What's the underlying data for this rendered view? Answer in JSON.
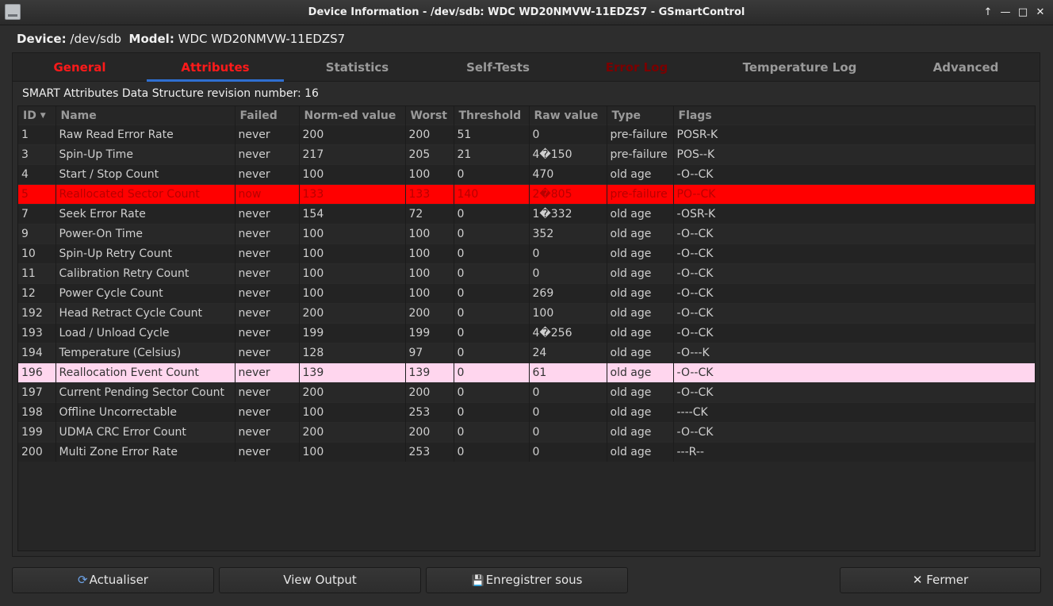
{
  "window": {
    "title": "Device Information - /dev/sdb: WDC WD20NMVW-11EDZS7 - GSmartControl",
    "buttons": [
      "↑",
      "—",
      "□",
      "✕"
    ]
  },
  "device": {
    "device_label": "Device:",
    "device_value": "/dev/sdb",
    "model_label": "Model:",
    "model_value": "WDC WD20NMVW-11EDZS7"
  },
  "tabs": [
    {
      "label": "General"
    },
    {
      "label": "Attributes"
    },
    {
      "label": "Statistics"
    },
    {
      "label": "Self-Tests"
    },
    {
      "label": "Error Log"
    },
    {
      "label": "Temperature Log"
    },
    {
      "label": "Advanced"
    }
  ],
  "revision_text": "SMART Attributes Data Structure revision number: 16",
  "table": {
    "columns": [
      "ID",
      "Name",
      "Failed",
      "Norm-ed value",
      "Worst",
      "Threshold",
      "Raw value",
      "Type",
      "Flags"
    ],
    "rows": [
      [
        "1",
        "Raw Read Error Rate",
        "never",
        "200",
        "200",
        "51",
        "0",
        "pre-failure",
        "POSR-K"
      ],
      [
        "3",
        "Spin-Up Time",
        "never",
        "217",
        "205",
        "21",
        "4�150",
        "pre-failure",
        "POS--K"
      ],
      [
        "4",
        "Start / Stop Count",
        "never",
        "100",
        "100",
        "0",
        "470",
        "old age",
        "-O--CK"
      ],
      [
        "5",
        "Reallocated Sector Count",
        "now",
        "133",
        "133",
        "140",
        "2�805",
        "pre-failure",
        "PO--CK"
      ],
      [
        "7",
        "Seek Error Rate",
        "never",
        "154",
        "72",
        "0",
        "1�332",
        "old age",
        "-OSR-K"
      ],
      [
        "9",
        "Power-On Time",
        "never",
        "100",
        "100",
        "0",
        "352",
        "old age",
        "-O--CK"
      ],
      [
        "10",
        "Spin-Up Retry Count",
        "never",
        "100",
        "100",
        "0",
        "0",
        "old age",
        "-O--CK"
      ],
      [
        "11",
        "Calibration Retry Count",
        "never",
        "100",
        "100",
        "0",
        "0",
        "old age",
        "-O--CK"
      ],
      [
        "12",
        "Power Cycle Count",
        "never",
        "100",
        "100",
        "0",
        "269",
        "old age",
        "-O--CK"
      ],
      [
        "192",
        "Head Retract Cycle Count",
        "never",
        "200",
        "200",
        "0",
        "100",
        "old age",
        "-O--CK"
      ],
      [
        "193",
        "Load / Unload Cycle",
        "never",
        "199",
        "199",
        "0",
        "4�256",
        "old age",
        "-O--CK"
      ],
      [
        "194",
        "Temperature (Celsius)",
        "never",
        "128",
        "97",
        "0",
        "24",
        "old age",
        "-O---K"
      ],
      [
        "196",
        "Reallocation Event Count",
        "never",
        "139",
        "139",
        "0",
        "61",
        "old age",
        "-O--CK"
      ],
      [
        "197",
        "Current Pending Sector Count",
        "never",
        "200",
        "200",
        "0",
        "0",
        "old age",
        "-O--CK"
      ],
      [
        "198",
        "Offline Uncorrectable",
        "never",
        "100",
        "253",
        "0",
        "0",
        "old age",
        "----CK"
      ],
      [
        "199",
        "UDMA CRC Error Count",
        "never",
        "200",
        "200",
        "0",
        "0",
        "old age",
        "-O--CK"
      ],
      [
        "200",
        "Multi Zone Error Rate",
        "never",
        "100",
        "253",
        "0",
        "0",
        "old age",
        "---R--"
      ]
    ]
  },
  "buttons": {
    "refresh": "Actualiser",
    "view_output": "View Output",
    "save_as": "Enregistrer sous",
    "close": "Fermer",
    "refresh_icon": "⟳",
    "save_icon": "💾",
    "close_icon": "✕"
  },
  "colors": {
    "failed_row": "#ff0000",
    "warning_row": "#ffd6ee",
    "active_tab_underline": "#2f6fd1"
  }
}
